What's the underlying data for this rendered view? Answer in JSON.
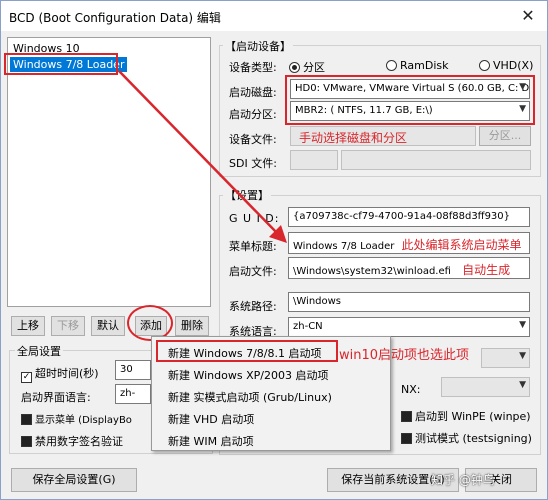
{
  "window": {
    "title": "BCD (Boot Configuration Data) 编辑",
    "close": "✕"
  },
  "entries": [
    {
      "label": "Windows 10"
    },
    {
      "label": "Windows 7/8 Loader"
    }
  ],
  "list_buttons": {
    "up": "上移",
    "down": "下移",
    "default": "默认",
    "add": "添加",
    "delete": "删除"
  },
  "boot_device": {
    "group_title": "【启动设备】",
    "type_label": "设备类型:",
    "type_options": [
      "分区",
      "RamDisk",
      "VHD(X)"
    ],
    "disk_label": "启动磁盘:",
    "disk_value": "HD0: VMware, VMware Virtual S (60.0 GB, C: D",
    "partition_label": "启动分区:",
    "partition_value": "MBR2: ( NTFS,  11.7 GB, E:\\)",
    "file_label": "设备文件:",
    "annotation": "手动选择磁盘和分区",
    "partition_button": "分区...",
    "sdi_label": "SDI 文件:"
  },
  "settings": {
    "group_title": "【设置】",
    "guid_label": "G U I D:",
    "guid_value": "{a709738c-cf79-4700-91a4-08f88d3ff930}",
    "menu_title_label": "菜单标题:",
    "menu_title_value": "Windows 7/8 Loader",
    "menu_title_annotation": "此处编辑系统启动菜单",
    "boot_file_label": "启动文件:",
    "boot_file_value": "\\Windows\\system32\\winload.efi",
    "boot_file_annotation": "自动生成",
    "sys_path_label": "系统路径:",
    "sys_path_value": "\\Windows",
    "sys_lang_label": "系统语言:",
    "sys_lang_value": "zh-CN",
    "nx_label": "NX:",
    "boot_winpe": "启动到 WinPE (winpe)",
    "test_mode": "测试模式 (testsigning)"
  },
  "global": {
    "group_title": "全局设置",
    "timeout_label": "超时时间(秒)",
    "timeout_value": "30",
    "ui_lang_label": "启动界面语言:",
    "ui_lang_value": "zh-",
    "show_menu": "显示菜单 (DisplayBo",
    "disable_sig": "禁用数字签名验证"
  },
  "add_menu": {
    "items": [
      "新建 Windows 7/8/8.1 启动项",
      "新建 Windows XP/2003 启动项",
      "新建 实模式启动项 (Grub/Linux)",
      "新建 VHD 启动项",
      "新建 WIM 启动项"
    ],
    "annotation": "win10启动项也选此项"
  },
  "bottom": {
    "save_global": "保存全局设置(G)",
    "save_current": "保存当前系统设置(S)",
    "close_label": "关闭"
  },
  "watermark": "知乎 @钟鸟",
  "colors": {
    "annotation_red": "#d9262c",
    "selection_blue": "#0078d7"
  }
}
